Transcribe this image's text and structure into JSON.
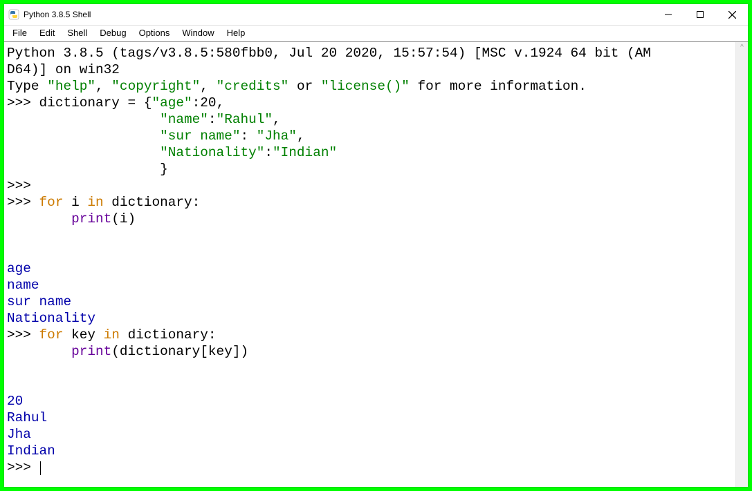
{
  "titlebar": {
    "title": "Python 3.8.5 Shell"
  },
  "menubar": {
    "file": "File",
    "edit": "Edit",
    "shell": "Shell",
    "debug": "Debug",
    "options": "Options",
    "window": "Window",
    "help": "Help"
  },
  "banner": {
    "line1": "Python 3.8.5 (tags/v3.8.5:580fbb0, Jul 20 2020, 15:57:54) [MSC v.1924 64 bit (AM",
    "line2": "D64)] on win32",
    "line3_pre": "Type ",
    "line3_help": "\"help\"",
    "line3_mid1": ", ",
    "line3_copyright": "\"copyright\"",
    "line3_mid2": ", ",
    "line3_credits": "\"credits\"",
    "line3_mid3": " or ",
    "line3_license": "\"license()\"",
    "line3_post": " for more information."
  },
  "prompt": ">>> ",
  "code": {
    "dict_assign": "dictionary = {",
    "k_age": "\"age\"",
    "v_age": ":20,",
    "indent1": "                   ",
    "k_name": "\"name\"",
    "colon": ":",
    "v_name": "\"Rahul\"",
    "comma": ",",
    "k_sur": "\"sur name\"",
    "colon_sp": ": ",
    "v_sur": "\"Jha\"",
    "k_nat": "\"Nationality\"",
    "v_nat": "\"Indian\"",
    "close_brace": "                   }",
    "for_kw": "for",
    "in_kw": "in",
    "loop1_var": " i ",
    "loop1_tail": " dictionary:",
    "indent_body": "        ",
    "print_fn": "print",
    "loop1_arg": "(i)",
    "loop2_var": " key ",
    "loop2_tail": " dictionary:",
    "loop2_arg": "(dictionary[key])"
  },
  "output1": {
    "l1": "age",
    "l2": "name",
    "l3": "sur name",
    "l4": "Nationality"
  },
  "output2": {
    "l1": "20",
    "l2": "Rahul",
    "l3": "Jha",
    "l4": "Indian"
  },
  "scroll_hint": "^"
}
